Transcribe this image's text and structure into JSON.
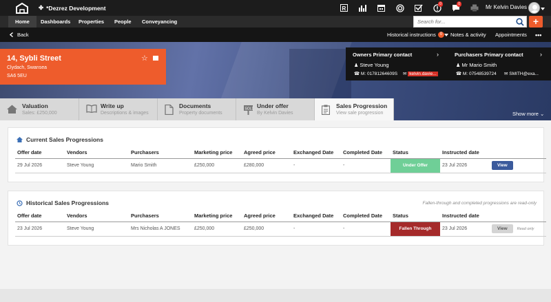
{
  "app": {
    "agency_name": "*Dezrez Development",
    "user_name": "Mr Kelvin Davies",
    "badges": {
      "alerts": "0",
      "messages": "0"
    }
  },
  "nav": {
    "items": [
      "Home",
      "Dashboards",
      "Properties",
      "People",
      "Conveyancing"
    ],
    "active": "Home",
    "search_placeholder": "Search for..."
  },
  "subnav": {
    "back_label": "Back",
    "historical_label": "Historical instructions",
    "historical_count": "0",
    "notes_label": "Notes & activity",
    "appointments_label": "Appointments"
  },
  "property": {
    "title": "14, Sybli Street",
    "line2": "Clydach, Swansea",
    "line3": "SA6 5EU"
  },
  "owners_contact": {
    "heading": "Owners Primary contact",
    "name": "Steve Young",
    "mobile": "M: 01781264609S",
    "email": "kelvin.davie..."
  },
  "purchasers_contact": {
    "heading": "Purchasers Primary contact",
    "name": "Mr Mario Smith",
    "mobile": "M: 07548539724",
    "email": "SMITH@exa..."
  },
  "show_more_label": "Show more",
  "tabs": [
    {
      "title": "Valuation",
      "subtitle": "Sales: £250,000",
      "icon": "house-icon"
    },
    {
      "title": "Write up",
      "subtitle": "Descriptions & images",
      "icon": "book-icon"
    },
    {
      "title": "Documents",
      "subtitle": "Property documents",
      "icon": "document-icon"
    },
    {
      "title": "Under offer",
      "subtitle": "By Kelvin Davies",
      "icon": "sale-sign-icon"
    },
    {
      "title": "Sales Progression",
      "subtitle": "View sale progression",
      "icon": "clipboard-icon"
    }
  ],
  "columns": [
    "Offer date",
    "Vendors",
    "Purchasers",
    "Marketing price",
    "Agreed price",
    "Exchanged Date",
    "Completed Date",
    "Status",
    "Instructed date"
  ],
  "current": {
    "title": "Current Sales Progressions",
    "rows": [
      {
        "offer_date": "29 Jul 2026",
        "vendors": "Steve Young",
        "purchasers": "Mario Smith",
        "marketing_price": "£250,000",
        "agreed_price": "£280,000",
        "exchanged": "-",
        "completed": "-",
        "status": "Under Offer",
        "instructed": "23 Jul 2026",
        "action": "View"
      }
    ]
  },
  "historical": {
    "title": "Historical Sales Progressions",
    "note": "Fallen-through and completed progressions are read-only",
    "rows": [
      {
        "offer_date": "23 Jul 2026",
        "vendors": "Steve Young",
        "purchasers": "Mrs Nicholas A JONES",
        "marketing_price": "£250,000",
        "agreed_price": "£250,000",
        "exchanged": "-",
        "completed": "-",
        "status": "Fallen Through",
        "instructed": "23 Jul 2026",
        "action": "View",
        "action_note": "Read only"
      }
    ]
  },
  "colors": {
    "accent": "#ee5c2c",
    "under_offer": "#6fcf97",
    "fallen_through": "#a52a2a",
    "view_button": "#3b5a9c"
  }
}
